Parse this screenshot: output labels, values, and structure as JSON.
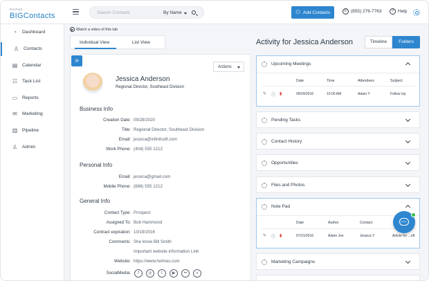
{
  "header": {
    "logo_small": "Pro Pack",
    "logo_main": "BIGContacts",
    "search_placeholder": "Search Contacts",
    "search_mode": "By Name",
    "add_contacts": "Add Contacts",
    "phone": "(855) 276-7763",
    "help": "Help"
  },
  "sidebar": {
    "items": [
      {
        "label": "Dashboard",
        "icon": "gauge-icon",
        "glyph": "◔"
      },
      {
        "label": "Contacts",
        "icon": "person-icon",
        "glyph": "♙"
      },
      {
        "label": "Calendar",
        "icon": "calendar-icon",
        "glyph": "▤"
      },
      {
        "label": "Task List",
        "icon": "tasklist-icon",
        "glyph": "☷"
      },
      {
        "label": "Reports",
        "icon": "report-icon",
        "glyph": "▭"
      },
      {
        "label": "Marketing",
        "icon": "mail-icon",
        "glyph": "✉"
      },
      {
        "label": "Pipeline",
        "icon": "pipeline-icon",
        "glyph": "▥"
      },
      {
        "label": "Admin",
        "icon": "admin-icon",
        "glyph": "♙"
      }
    ]
  },
  "view": {
    "video_link": "Watch a video of this tab",
    "tab_individual": "Individual View",
    "tab_list": "List View"
  },
  "contact": {
    "actions": "Actions",
    "name": "Jessica Anderson",
    "role": "Regional Director, Southeast Division",
    "business_info": "Business Info",
    "creation_date_label": "Creation Date:",
    "creation_date": "09/28/2020",
    "title_label": "Title:",
    "title": "Regional Director, Southeast Division",
    "email_label": "Email:",
    "email": "jessica@infinitsoft.com",
    "work_phone_label": "Work Phone:",
    "work_phone": "(404) 555 1212",
    "personal_info": "Personal Info",
    "p_email_label": "Email:",
    "p_email": "jessica@gmail.com",
    "mobile_label": "Mobile Phone:",
    "mobile": "(888) 555 1212",
    "general_info": "General Info",
    "contact_type_label": "Contact Type:",
    "contact_type": "Prospect",
    "assigned_label": "Assigned To:",
    "assigned": "Bob Hammond",
    "expiration_label": "Contract expiration:",
    "expiration": "10/19/2016",
    "comments_label": "Comments:",
    "comments_1": "She know Bill Smith",
    "comments_2": "Important website information Link",
    "website_label": "Website:",
    "website": "https://www.holmes.com",
    "social_label": "SocialMedia:"
  },
  "activity": {
    "title": "Activity for Jessica Anderson",
    "timeline": "Timeline",
    "folders": "Folders",
    "upcoming": {
      "title": "Upcoming Meetings",
      "headers": [
        "Date",
        "Time",
        "Attendees",
        "Subject"
      ],
      "row": [
        "09/24/2016",
        "10:00 AM",
        "Adam Y",
        "Follow Up"
      ]
    },
    "pending": "Pending Tasks",
    "contact_history": "Contact History",
    "opportunities": "Opportunities",
    "files": "Files and Photos",
    "notepad": {
      "title": "Note Pad",
      "headers": [
        "Date",
        "Author",
        "Contact"
      ],
      "row": [
        "07/21/2016",
        "Adam Joe",
        "Jessica Y",
        "Article for ...off"
      ]
    },
    "marketing": "Marketing Campaigns"
  }
}
